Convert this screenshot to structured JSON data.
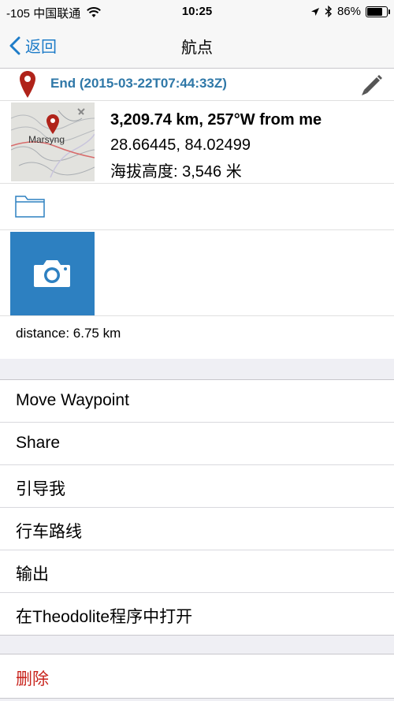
{
  "status_bar": {
    "carrier": "-105 中国联通",
    "time": "10:25",
    "battery": "86%",
    "battery_level": 0.86
  },
  "nav": {
    "back_label": "返回",
    "title": "航点"
  },
  "waypoint": {
    "title": "End (2015-03-22T07:44:33Z)",
    "distance_bearing": "3,209.74 km, 257°W from me",
    "coordinates": "28.66445, 84.02499",
    "altitude": "海拔高度: 3,546 米",
    "map_label": "Marsyng",
    "distance_info": "distance: 6.75 km"
  },
  "menu": {
    "items": [
      {
        "label": "Move Waypoint"
      },
      {
        "label": "Share"
      },
      {
        "label": "引导我"
      },
      {
        "label": "行车路线"
      },
      {
        "label": "输出"
      },
      {
        "label": "在Theodolite程序中打开"
      }
    ]
  },
  "delete_label": "删除",
  "colors": {
    "accent": "#1e7cc8",
    "title_blue": "#2f78a8",
    "pin_red": "#b0231a",
    "photo_box": "#2d80c1",
    "delete_red": "#c8231c"
  }
}
